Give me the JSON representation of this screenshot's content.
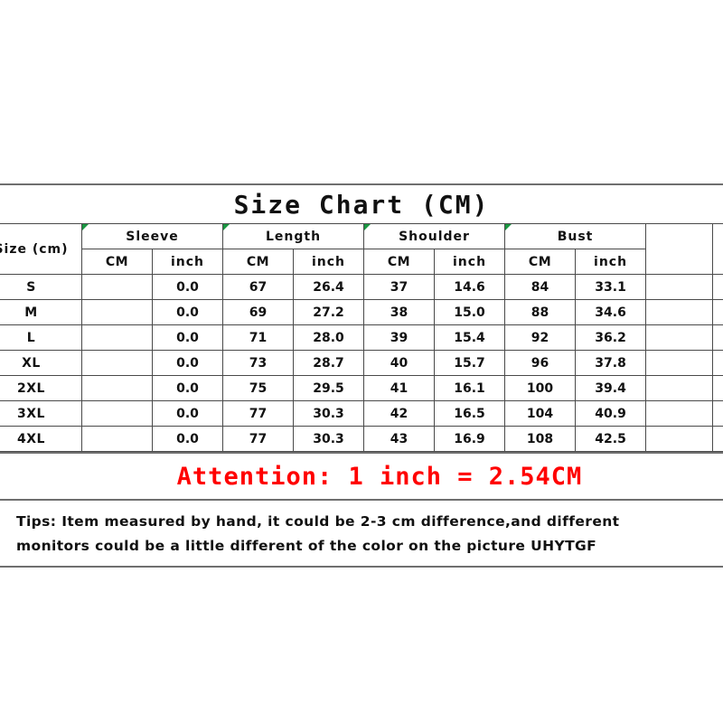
{
  "title": "Size Chart (CM)",
  "table": {
    "size_header": "Size (cm)",
    "groups": [
      {
        "label": "Sleeve",
        "marker": true
      },
      {
        "label": "Length",
        "marker": true
      },
      {
        "label": "Shoulder",
        "marker": true
      },
      {
        "label": "Bust",
        "marker": true
      }
    ],
    "unit_headers": [
      "CM",
      "inch",
      "CM",
      "inch",
      "CM",
      "inch",
      "CM",
      "inch"
    ],
    "trailing_empty_columns": 2,
    "rows": [
      {
        "size": "S",
        "sleeve_cm": "",
        "sleeve_in": "0.0",
        "length_cm": "67",
        "length_in": "26.4",
        "shoulder_cm": "37",
        "shoulder_in": "14.6",
        "bust_cm": "84",
        "bust_in": "33.1"
      },
      {
        "size": "M",
        "sleeve_cm": "",
        "sleeve_in": "0.0",
        "length_cm": "69",
        "length_in": "27.2",
        "shoulder_cm": "38",
        "shoulder_in": "15.0",
        "bust_cm": "88",
        "bust_in": "34.6"
      },
      {
        "size": "L",
        "sleeve_cm": "",
        "sleeve_in": "0.0",
        "length_cm": "71",
        "length_in": "28.0",
        "shoulder_cm": "39",
        "shoulder_in": "15.4",
        "bust_cm": "92",
        "bust_in": "36.2"
      },
      {
        "size": "XL",
        "sleeve_cm": "",
        "sleeve_in": "0.0",
        "length_cm": "73",
        "length_in": "28.7",
        "shoulder_cm": "40",
        "shoulder_in": "15.7",
        "bust_cm": "96",
        "bust_in": "37.8"
      },
      {
        "size": "2XL",
        "sleeve_cm": "",
        "sleeve_in": "0.0",
        "length_cm": "75",
        "length_in": "29.5",
        "shoulder_cm": "41",
        "shoulder_in": "16.1",
        "bust_cm": "100",
        "bust_in": "39.4"
      },
      {
        "size": "3XL",
        "sleeve_cm": "",
        "sleeve_in": "0.0",
        "length_cm": "77",
        "length_in": "30.3",
        "shoulder_cm": "42",
        "shoulder_in": "16.5",
        "bust_cm": "104",
        "bust_in": "40.9"
      },
      {
        "size": "4XL",
        "sleeve_cm": "",
        "sleeve_in": "0.0",
        "length_cm": "77",
        "length_in": "30.3",
        "shoulder_cm": "43",
        "shoulder_in": "16.9",
        "bust_cm": "108",
        "bust_in": "42.5"
      }
    ]
  },
  "attention": "Attention: 1 inch = 2.54CM",
  "tips": {
    "line1": "Tips: Item measured by hand, it could be 2-3 cm difference,and different",
    "line2": "monitors could be a little different of the color on the picture UHYTGF"
  },
  "colors": {
    "accent_red": "#ff0000",
    "text": "#111111",
    "border": "#4a4a4a",
    "rule": "#6f6f6f",
    "marker_green": "#1a9641",
    "background": "#ffffff"
  }
}
